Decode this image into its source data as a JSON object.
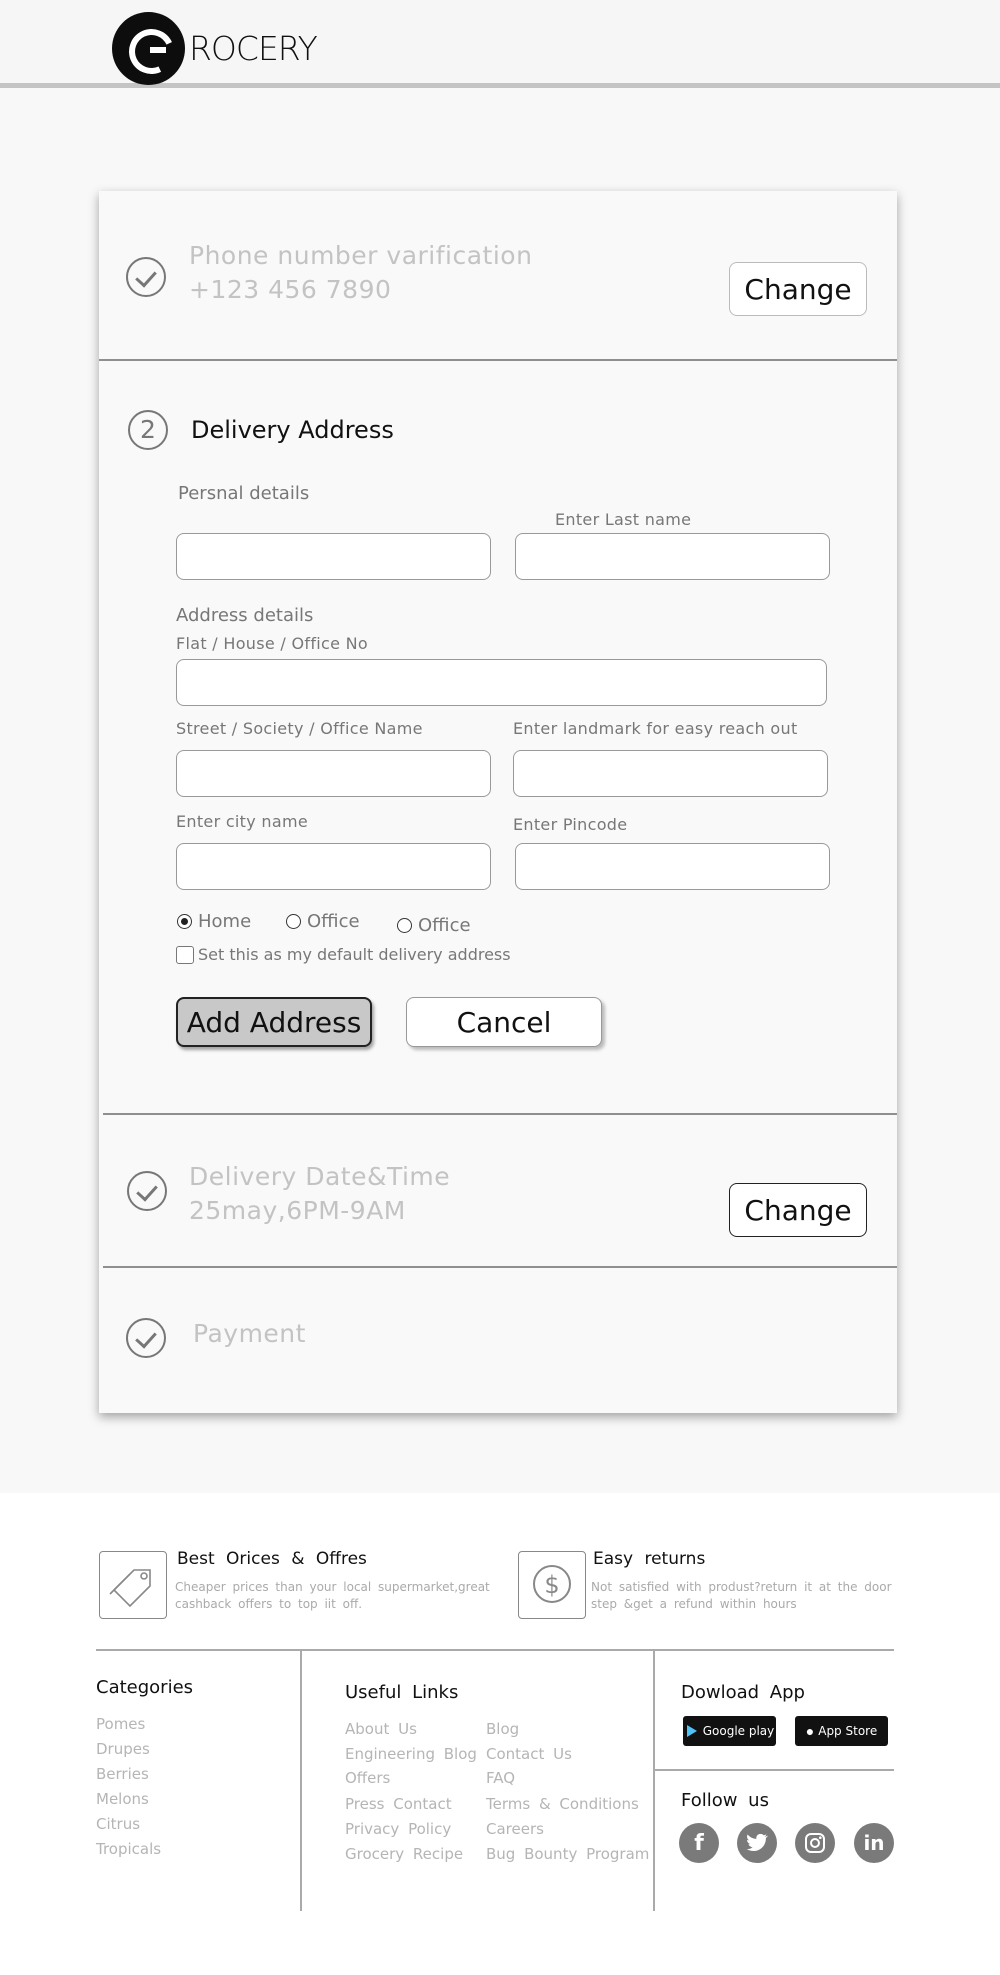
{
  "header": {
    "logo_text": "ROCERY"
  },
  "steps": {
    "phone": {
      "title": "Phone number varification",
      "value": "+123 456 7890",
      "change_label": "Change"
    },
    "address": {
      "number": "2",
      "title": "Delivery Address",
      "personal_label": "Persnal details",
      "last_name_label": "Enter Last name",
      "address_label": "Address details",
      "flat_label": "Flat / House / Office No",
      "street_label": "Street / Society / Office Name",
      "landmark_label": "Enter landmark for easy reach out",
      "city_label": "Enter city name",
      "pincode_label": "Enter Pincode",
      "radio_home": "Home",
      "radio_office_1": "Office",
      "radio_office_2": "Office",
      "default_checkbox": "Set this as my default delivery address",
      "add_label": "Add Address",
      "cancel_label": "Cancel"
    },
    "delivery": {
      "title": "Delivery Date&Time",
      "value": "25may,6PM-9AM",
      "change_label": "Change"
    },
    "payment": {
      "title": "Payment"
    }
  },
  "footer": {
    "feature_1": {
      "title": "Best Orices & Offres",
      "desc_1": "Cheaper prices than your local supermarket,great",
      "desc_2": "cashback offers to top iit off."
    },
    "feature_2": {
      "title": "Easy returns",
      "desc_1": "Not satisfied with produst?return it at the door",
      "desc_2": "step &get a refund within hours"
    },
    "categories": {
      "title": "Categories",
      "items": [
        "Pomes",
        "Drupes",
        "Berries",
        "Melons",
        "Citrus",
        "Tropicals"
      ]
    },
    "useful_links": {
      "title": "Useful Links",
      "left": [
        "About Us",
        "Engineering Blog",
        "Offers",
        "Press Contact",
        "Privacy Policy",
        "Grocery Recipe"
      ],
      "right": [
        "Blog",
        "Contact Us",
        "FAQ",
        "Terms & Conditions",
        "Careers",
        "Bug Bounty Program"
      ]
    },
    "app": {
      "title": "Dowload App",
      "google_play": "Google play",
      "app_store": "App Store"
    },
    "follow": {
      "title": "Follow us",
      "icons": [
        "facebook-icon",
        "twitter-icon",
        "instagram-icon",
        "linkedin-icon"
      ]
    }
  }
}
